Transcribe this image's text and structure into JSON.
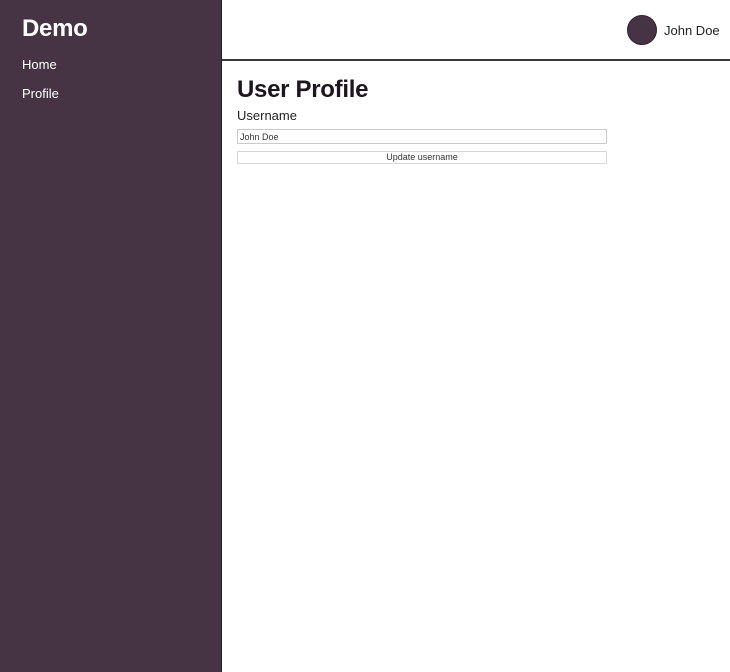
{
  "sidebar": {
    "title": "Demo",
    "items": [
      {
        "label": "Home"
      },
      {
        "label": "Profile"
      }
    ]
  },
  "header": {
    "user_name": "John Doe",
    "avatar_icon": "user-avatar-circle"
  },
  "main": {
    "title": "User Profile",
    "username_label": "Username",
    "username_value": "John Doe",
    "update_button_label": "Update username"
  },
  "colors": {
    "brand": "#463445",
    "text_dark": "#1f1520"
  }
}
